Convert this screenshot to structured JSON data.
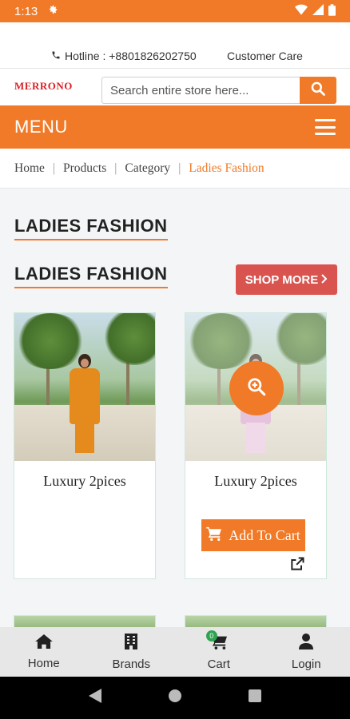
{
  "status_bar": {
    "time": "1:13",
    "settings_icon": "gear-icon",
    "wifi_icon": "wifi-icon",
    "signal_icon": "signal-icon",
    "battery_icon": "battery-icon"
  },
  "top_info": {
    "hotline": "Hotline : +8801826202750",
    "customer_care": "Customer Care"
  },
  "brand": {
    "logo_text": "MERRONO"
  },
  "search": {
    "placeholder": "Search entire store here...",
    "value": ""
  },
  "menu": {
    "label": "MENU"
  },
  "breadcrumb": {
    "items": [
      "Home",
      "Products",
      "Category",
      "Ladies Fashion"
    ]
  },
  "page": {
    "title": "LADIES FASHION",
    "section_title": "LADIES FASHION",
    "shop_more": "SHOP MORE"
  },
  "products": [
    {
      "name": "Luxury 2pices"
    },
    {
      "name": "Luxury 2pices",
      "add_to_cart": "Add To Cart"
    }
  ],
  "bottom_nav": {
    "items": [
      {
        "label": "Home",
        "icon": "home-icon"
      },
      {
        "label": "Brands",
        "icon": "building-icon"
      },
      {
        "label": "Cart",
        "icon": "cart-icon",
        "badge": "0"
      },
      {
        "label": "Login",
        "icon": "user-icon"
      }
    ]
  },
  "colors": {
    "accent": "#f07a28",
    "shop_more": "#d9534f",
    "badge": "#2ea44f"
  }
}
